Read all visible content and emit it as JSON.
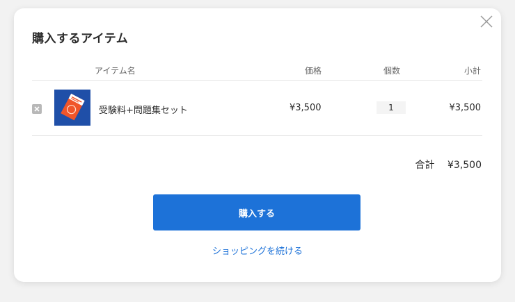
{
  "modal": {
    "title": "購入するアイテム",
    "close_icon": "close-icon"
  },
  "table": {
    "headers": {
      "name": "アイテム名",
      "price": "価格",
      "quantity": "個数",
      "subtotal": "小計"
    },
    "rows": [
      {
        "remove_icon": "remove-x-icon",
        "thumbnail": "book-cover-image",
        "name": "受験料+問題集セット",
        "price": "¥3,500",
        "quantity": "1",
        "subtotal": "¥3,500"
      }
    ]
  },
  "total": {
    "label": "合計",
    "value": "¥3,500"
  },
  "actions": {
    "purchase_label": "購入する",
    "continue_label": "ショッピングを続ける"
  },
  "colors": {
    "accent": "#1d72d8",
    "thumbnail_bg": "#1f4fa8",
    "thumbnail_book": "#f0552a"
  }
}
